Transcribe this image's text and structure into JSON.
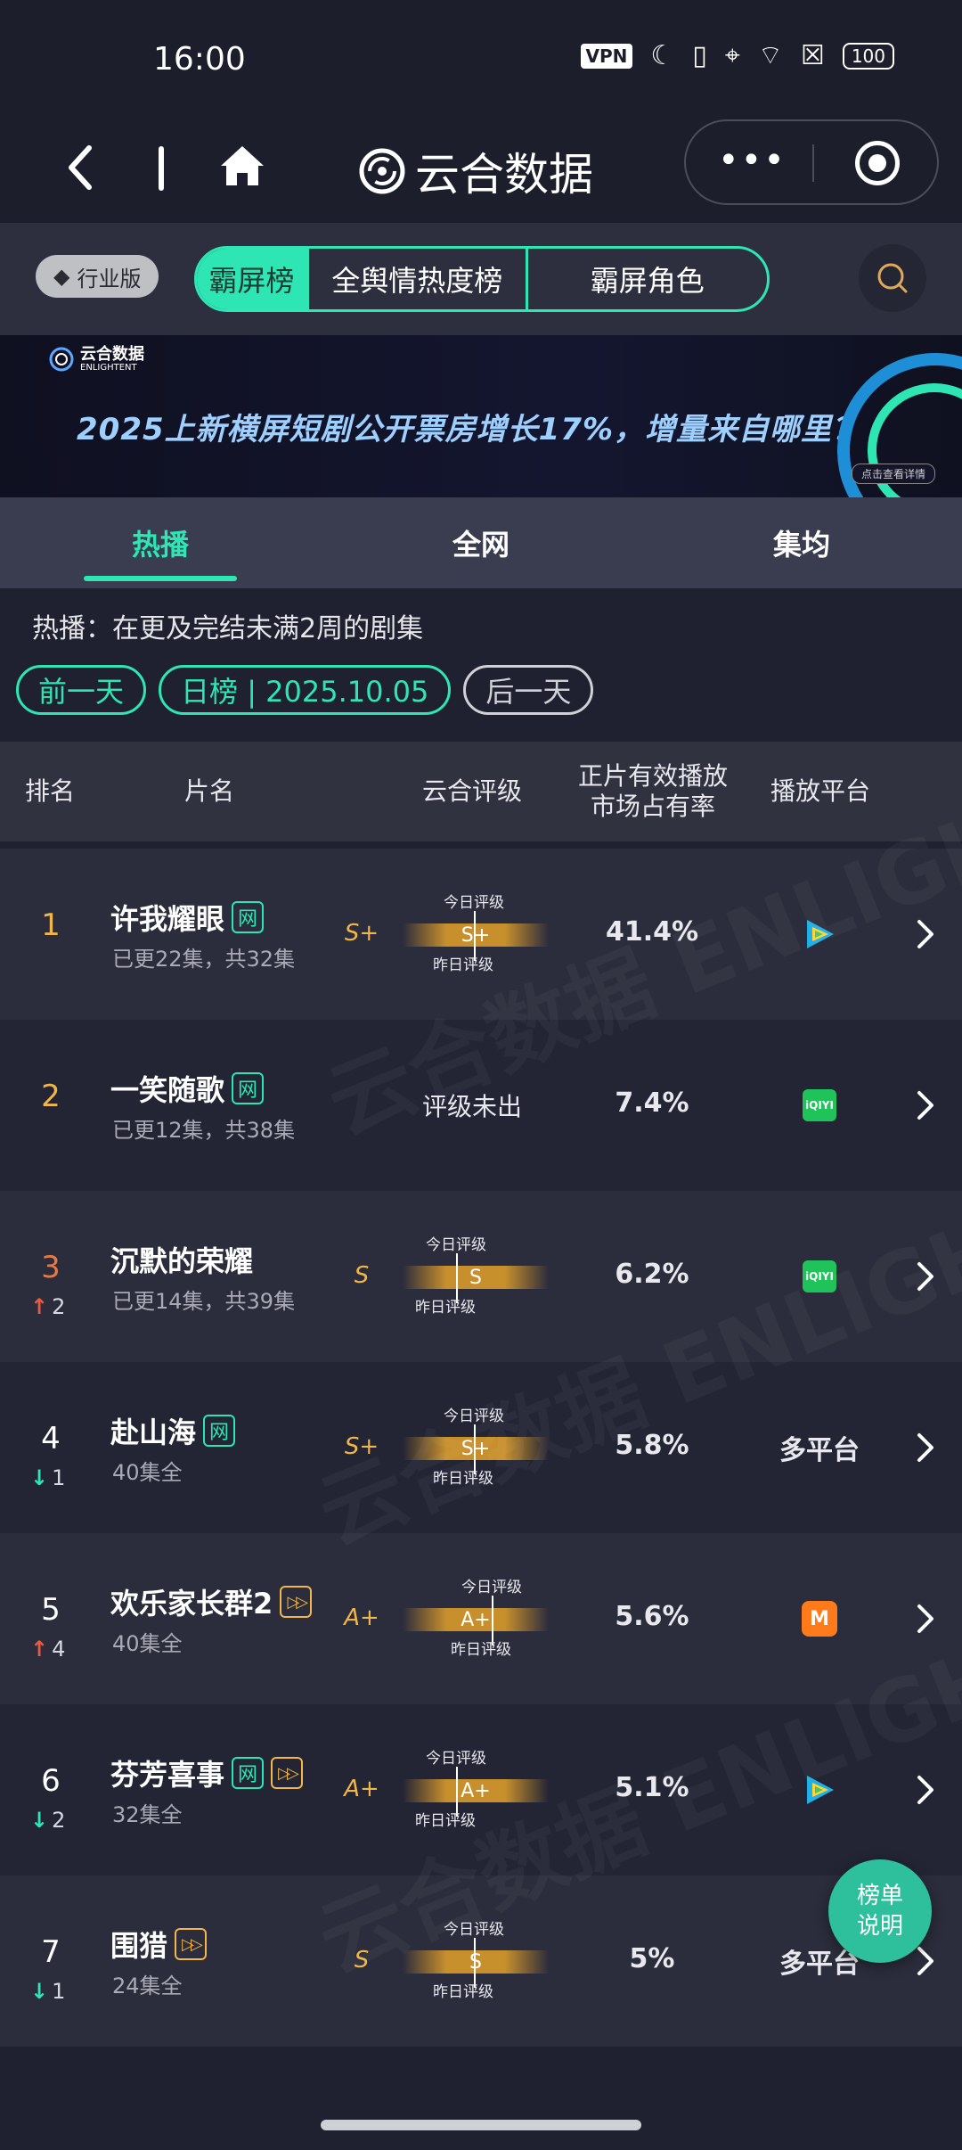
{
  "status_bar": {
    "time": "16:00",
    "vpn": "VPN",
    "battery": "100"
  },
  "nav": {
    "app_name": "云合数据"
  },
  "top_tabs": {
    "edition_badge": "行业版",
    "tabs": [
      "霸屏榜",
      "全舆情热度榜",
      "霸屏角色"
    ],
    "active_tab": "霸屏榜"
  },
  "banner": {
    "logo_text": "云合数据",
    "logo_sub": "ENLIGHTENT",
    "headline": "2025上新横屏短剧公开票房增长17%，增量来自哪里？",
    "cta": "点击查看详情"
  },
  "sub_tabs": {
    "items": [
      "热播",
      "全网",
      "集均"
    ],
    "active": "热播"
  },
  "description": "热播：在更及完结未满2周的剧集",
  "date_nav": {
    "prev": "前一天",
    "current": "日榜 | 2025.10.05",
    "next": "后一天"
  },
  "table": {
    "headers": {
      "rank": "排名",
      "title": "片名",
      "rating": "云合评级",
      "share": "正片有效播放\n市场占有率",
      "platform": "播放平台"
    },
    "grade_today_label": "今日评级",
    "grade_yesterday_label": "昨日评级",
    "rows": [
      {
        "rank": "1",
        "title": "许我耀眼",
        "tags": [
          "网"
        ],
        "episodes": "已更22集，共32集",
        "grade_code": "S+",
        "grade": "S+",
        "share": "41.4%",
        "platform": "tencent",
        "trend": "",
        "trend_dir": ""
      },
      {
        "rank": "2",
        "title": "一笑随歌",
        "tags": [
          "网"
        ],
        "episodes": "已更12集，共38集",
        "grade_code": "",
        "grade": "评级未出",
        "share": "7.4%",
        "platform": "iqiyi",
        "trend": "",
        "trend_dir": ""
      },
      {
        "rank": "3",
        "title": "沉默的荣耀",
        "tags": [],
        "episodes": "已更14集，共39集",
        "grade_code": "S",
        "grade": "S",
        "share": "6.2%",
        "platform": "iqiyi",
        "trend": "2",
        "trend_dir": "up"
      },
      {
        "rank": "4",
        "title": "赴山海",
        "tags": [
          "网"
        ],
        "episodes": "40集全",
        "grade_code": "S+",
        "grade": "S+",
        "share": "5.8%",
        "platform": "多平台",
        "trend": "1",
        "trend_dir": "down"
      },
      {
        "rank": "5",
        "title": "欢乐家长群2",
        "tags": [
          "play"
        ],
        "episodes": "40集全",
        "grade_code": "A+",
        "grade": "A+",
        "share": "5.6%",
        "platform": "mango",
        "trend": "4",
        "trend_dir": "up"
      },
      {
        "rank": "6",
        "title": "芬芳喜事",
        "tags": [
          "网",
          "play"
        ],
        "episodes": "32集全",
        "grade_code": "A+",
        "grade": "A+",
        "share": "5.1%",
        "platform": "tencent",
        "trend": "2",
        "trend_dir": "down"
      },
      {
        "rank": "7",
        "title": "围猎",
        "tags": [
          "play"
        ],
        "episodes": "24集全",
        "grade_code": "S",
        "grade": "S",
        "share": "5%",
        "platform": "多平台",
        "trend": "1",
        "trend_dir": "down"
      }
    ]
  },
  "platform_labels": {
    "iqiyi": "iQIYI",
    "mango": "M"
  },
  "float_button": [
    "榜单",
    "说明"
  ],
  "colors": {
    "accent": "#2ee6b4",
    "gold": "#f0b64a",
    "up": "#e85b3f",
    "background": "#1f2130"
  },
  "watermark": "云合数据 ENLIGHTENT"
}
